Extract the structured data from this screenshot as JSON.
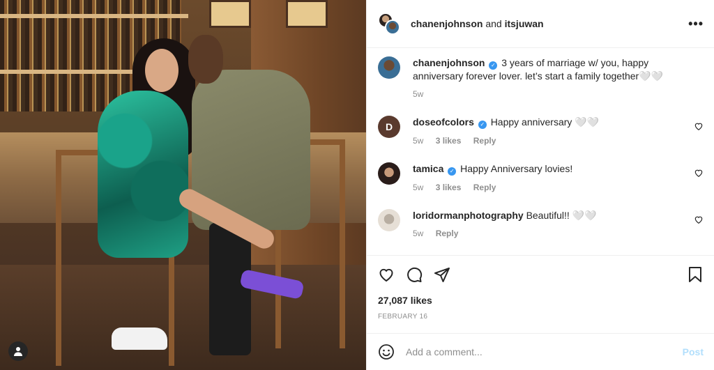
{
  "post": {
    "header": {
      "user1": "chanenjohnson",
      "and": "and",
      "user2": "itsjuwan",
      "more": "•••"
    },
    "caption": {
      "username": "chanenjohnson",
      "text": "3 years of marriage w/ you, happy anniversary forever lover. let’s start a family together🤍🤍",
      "time": "5w"
    },
    "comments": [
      {
        "username": "doseofcolors",
        "verified": true,
        "text": "Happy anniversary 🤍🤍",
        "time": "5w",
        "likes": "3 likes",
        "reply": "Reply",
        "avatar_color": "#5a3a2e",
        "avatar_letter": "D"
      },
      {
        "username": "tamica",
        "verified": true,
        "text": "Happy Anniversary lovies!",
        "time": "5w",
        "likes": "3 likes",
        "reply": "Reply",
        "avatar_color": "#2a1d1a"
      },
      {
        "username": "loridormanphotography",
        "verified": false,
        "text": "Beautiful!! 🤍🤍",
        "time": "5w",
        "likes": "",
        "reply": "Reply",
        "avatar_color": "#d9d2c8"
      }
    ],
    "likes": "27,087 likes",
    "date": "FEBRUARY 16",
    "add_comment": {
      "placeholder": "Add a comment...",
      "post_label": "Post"
    }
  },
  "colors": {
    "accent": "#3897f0",
    "post_disabled": "#b2dffc",
    "meta": "#8e8e8e"
  },
  "icons": [
    "heart-icon",
    "comment-icon",
    "share-icon",
    "bookmark-icon",
    "emoji-icon",
    "more-icon",
    "user-icon",
    "verified-icon"
  ]
}
